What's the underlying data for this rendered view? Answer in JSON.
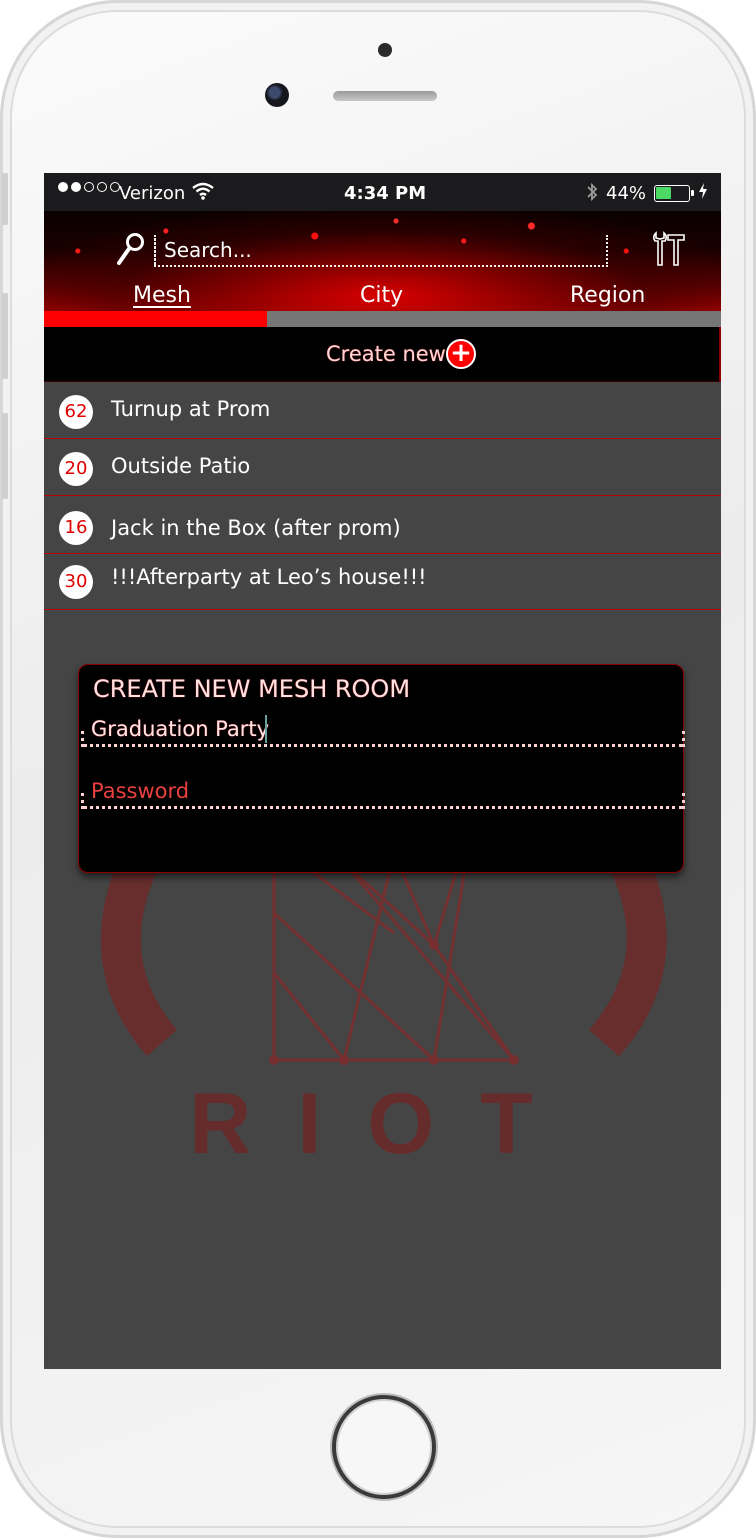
{
  "status_bar": {
    "carrier": "Verizon",
    "time": "4:34 PM",
    "battery": "44%"
  },
  "header": {
    "search_placeholder": "Search...",
    "tabs": [
      {
        "label": "Mesh",
        "active": true
      },
      {
        "label": "City",
        "active": false
      },
      {
        "label": "Region",
        "active": false
      }
    ]
  },
  "create_new": {
    "label": "Create new"
  },
  "rooms": [
    {
      "count": "62",
      "name": "Turnup at Prom"
    },
    {
      "count": "20",
      "name": "Outside Patio"
    },
    {
      "count": "16",
      "name": "Jack in the Box (after prom)"
    },
    {
      "count": "30",
      "name": "!!!Afterparty at Leo’s house!!!"
    }
  ],
  "dialog": {
    "title": "CREATE NEW MESH ROOM",
    "name_value": "Graduation Party",
    "password_placeholder": "Password"
  },
  "logo": {
    "text": "RIOT"
  },
  "colors": {
    "accent": "#ff0000",
    "background": "#454545",
    "bar": "#000000"
  }
}
